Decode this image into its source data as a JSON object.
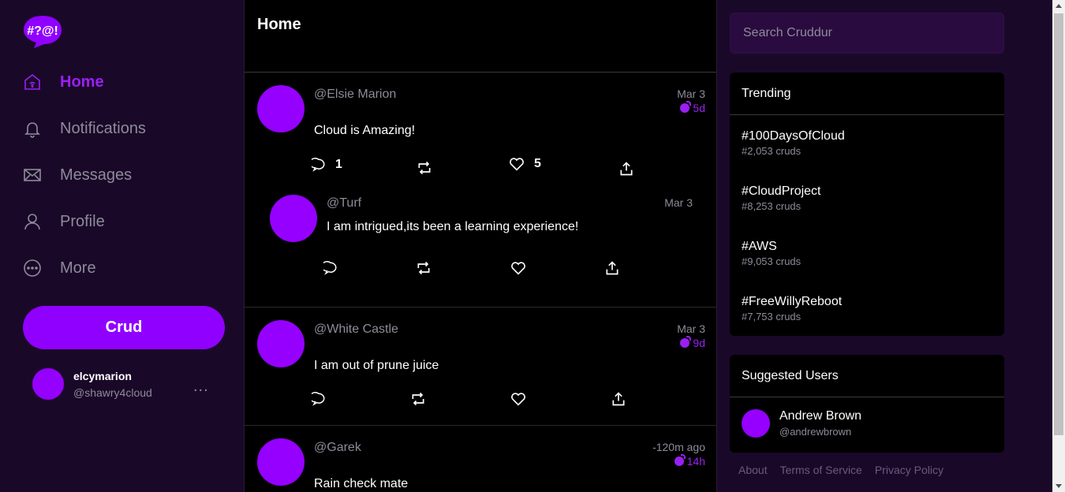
{
  "brand": {
    "logo_text": "#?@!",
    "accent": "#9000ff",
    "background": "#1a0829"
  },
  "nav": {
    "items": [
      {
        "label": "Home",
        "icon": "home-icon",
        "active": true
      },
      {
        "label": "Notifications",
        "icon": "bell-icon",
        "active": false
      },
      {
        "label": "Messages",
        "icon": "envelope-icon",
        "active": false
      },
      {
        "label": "Profile",
        "icon": "user-icon",
        "active": false
      },
      {
        "label": "More",
        "icon": "more-circle-icon",
        "active": false
      }
    ],
    "crud_button": "Crud"
  },
  "current_user": {
    "name": "elcymarion",
    "handle": "@shawry4cloud",
    "menu": "..."
  },
  "feed": {
    "title": "Home",
    "posts": [
      {
        "handle": "@Elsie Marion",
        "date": "Mar 3",
        "ttl": "5d",
        "text": "Cloud is Amazing!",
        "replies": "1",
        "likes": "5"
      },
      {
        "handle": "@Turf",
        "date": "Mar 3",
        "text": "I am intrigued,its been a learning experience!"
      },
      {
        "handle": "@White Castle",
        "date": "Mar 3",
        "ttl": "9d",
        "text": "I am out of prune juice"
      },
      {
        "handle": "@Garek",
        "date": "-120m ago",
        "ttl": "14h",
        "text": "Rain check mate"
      }
    ]
  },
  "search": {
    "placeholder": "Search Cruddur"
  },
  "trending": {
    "title": "Trending",
    "items": [
      {
        "tag": "#100DaysOfCloud",
        "count": "#2,053 cruds"
      },
      {
        "tag": "#CloudProject",
        "count": "#8,253 cruds"
      },
      {
        "tag": "#AWS",
        "count": "#9,053 cruds"
      },
      {
        "tag": "#FreeWillyReboot",
        "count": "#7,753 cruds"
      }
    ]
  },
  "suggested": {
    "title": "Suggested Users",
    "users": [
      {
        "name": "Andrew Brown",
        "handle": "@andrewbrown"
      }
    ]
  },
  "footer": {
    "links": [
      "About",
      "Terms of Service",
      "Privacy Policy"
    ]
  }
}
